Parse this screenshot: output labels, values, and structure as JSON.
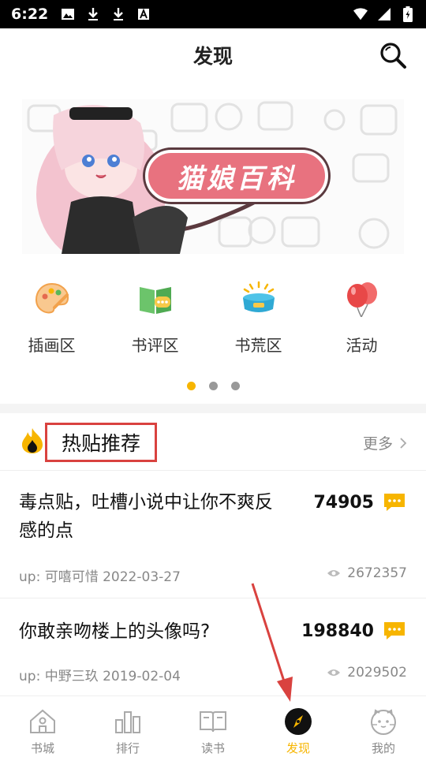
{
  "status_bar": {
    "time": "6:22"
  },
  "header": {
    "title": "发现"
  },
  "banner": {
    "caption": "猫娘百科"
  },
  "categories": [
    {
      "label": "插画区",
      "icon": "palette-icon"
    },
    {
      "label": "书评区",
      "icon": "book-comment-icon"
    },
    {
      "label": "书荒区",
      "icon": "bowl-icon"
    },
    {
      "label": "活动",
      "icon": "balloon-icon"
    }
  ],
  "hot": {
    "title": "热贴推荐",
    "more": "更多"
  },
  "posts": [
    {
      "title_line1": "毒点贴，吐槽小说中让你不爽反",
      "title_line2": "感的点",
      "count": "74905",
      "meta": "up: 可嘻可惜 2022-03-27",
      "views": "2672357"
    },
    {
      "title_line1": "你敢亲吻楼上的头像吗?",
      "title_line2": "",
      "count": "198840",
      "meta": "up: 中野三玖 2019-02-04",
      "views": "2029502"
    }
  ],
  "tabs": [
    {
      "label": "书城"
    },
    {
      "label": "排行"
    },
    {
      "label": "读书"
    },
    {
      "label": "发现"
    },
    {
      "label": "我的"
    }
  ],
  "colors": {
    "accent": "#f7b500",
    "highlight_box": "#d9423f"
  }
}
